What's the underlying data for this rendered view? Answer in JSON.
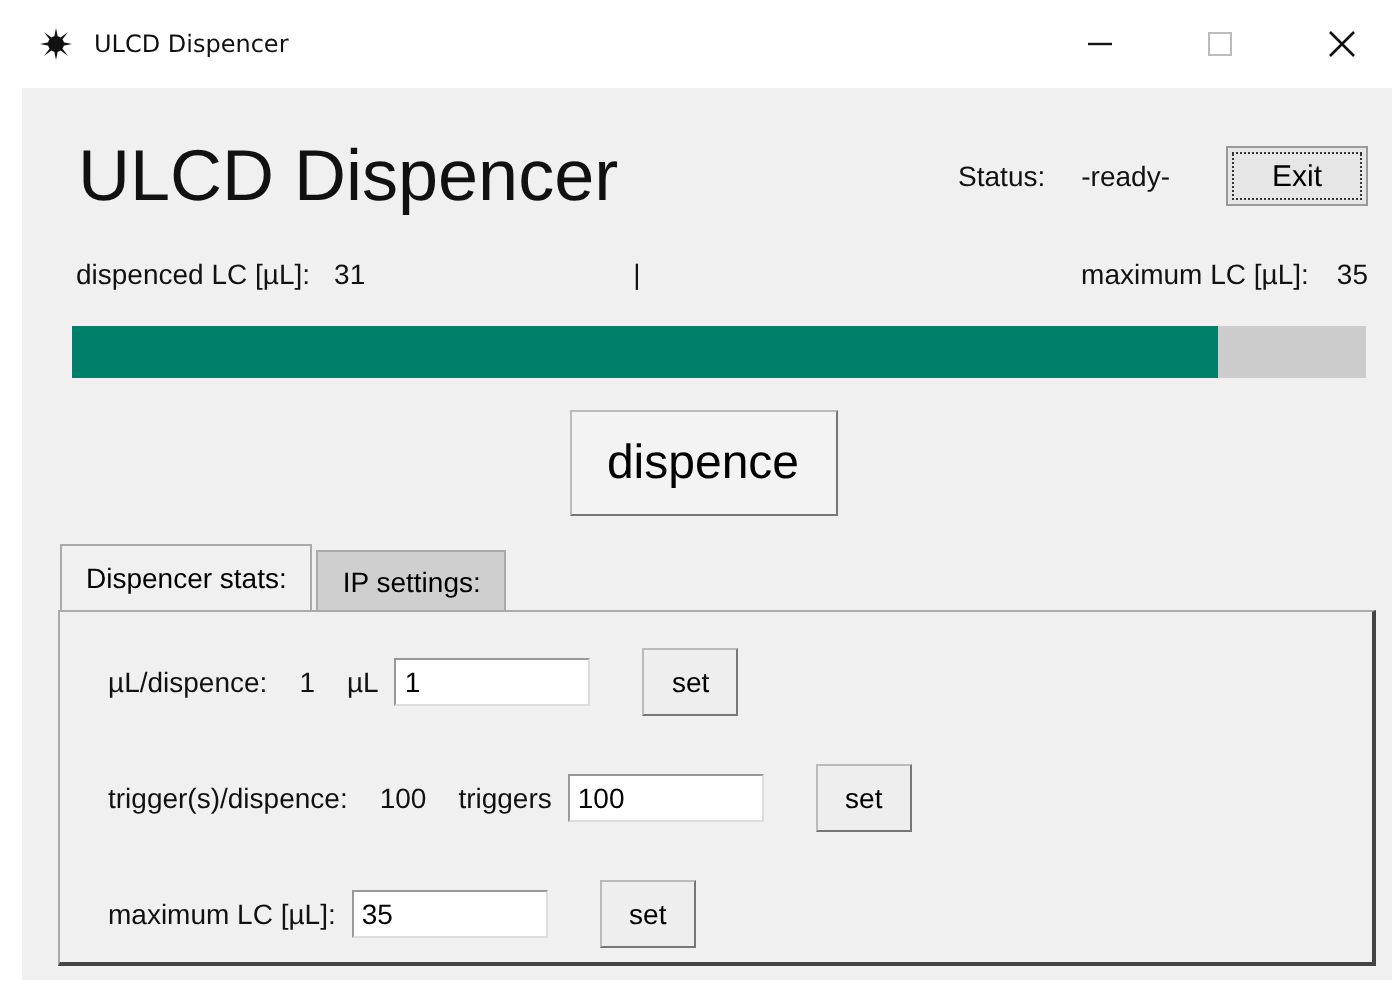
{
  "window": {
    "title": "ULCD Dispencer"
  },
  "header": {
    "title": "ULCD Dispencer",
    "status_label": "Status:",
    "status_value": "-ready-",
    "exit_button": "Exit"
  },
  "counter": {
    "dispensed_label": "dispenced LC [µL]:",
    "dispensed_value": "31",
    "separator": "|",
    "maximum_label": "maximum LC [µL]:",
    "maximum_value": "35"
  },
  "progress": {
    "level": 0.886
  },
  "dispence_button": "dispence",
  "tabs": [
    {
      "label": "Dispencer stats:",
      "selected": true
    },
    {
      "label": "IP settings:",
      "selected": false
    }
  ],
  "settings": [
    {
      "label": "µL/dispence:",
      "value": "1",
      "unit": "µL",
      "input": "1",
      "button": "set"
    },
    {
      "label": "trigger(s)/dispence:",
      "value": "100",
      "unit": "triggers",
      "input": "100",
      "button": "set"
    },
    {
      "label": "maximum LC [µL]:",
      "input": "35",
      "button": "set"
    }
  ]
}
